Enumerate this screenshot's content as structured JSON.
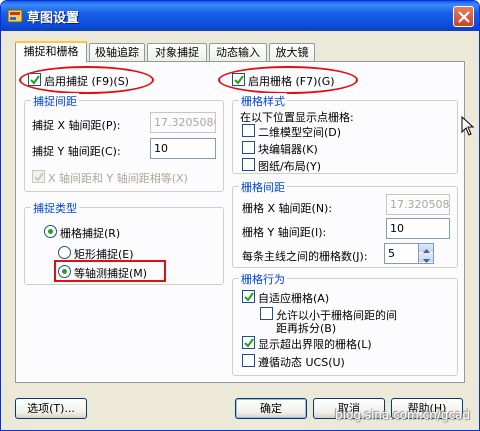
{
  "window": {
    "title": "草图设置"
  },
  "tabs": [
    {
      "label": "捕捉和栅格"
    },
    {
      "label": "极轴追踪"
    },
    {
      "label": "对象捕捉"
    },
    {
      "label": "动态输入"
    },
    {
      "label": "放大镜"
    }
  ],
  "snap": {
    "enable_label": "启用捕捉 (F9)(S)",
    "spacing_group": "捕捉间距",
    "x_label": "捕捉 X 轴间距(P):",
    "x_value": "17.3205080",
    "y_label": "捕捉 Y 轴间距(C):",
    "y_value": "10",
    "equal_label": "X 轴间距和 Y 轴间距相等(X)",
    "type_group": "捕捉类型",
    "grid_snap": "栅格捕捉(R)",
    "rect_snap": "矩形捕捉(E)",
    "iso_snap": "等轴测捕捉(M)"
  },
  "grid": {
    "enable_label": "启用栅格 (F7)(G)",
    "style_group": "栅格样式",
    "style_hint": "在以下位置显示点栅格:",
    "model_space": "二维模型空间(D)",
    "block_editor": "块编辑器(K)",
    "sheet_layout": "图纸/布局(Y)",
    "spacing_group": "栅格间距",
    "x_label": "栅格 X 轴间距(N):",
    "x_value": "17.3205080",
    "y_label": "栅格 Y 轴间距(I):",
    "y_value": "10",
    "major_label": "每条主线之间的栅格数(J):",
    "major_value": "5",
    "behavior_group": "栅格行为",
    "adaptive": "自适应栅格(A)",
    "allow_sub_1": "允许以小于栅格间距的间",
    "allow_sub_2": "距再拆分(B)",
    "beyond_limits": "显示超出界限的栅格(L)",
    "follow_ucs": "遵循动态 UCS(U)"
  },
  "buttons": {
    "options": "选项(T)...",
    "ok": "确定",
    "cancel": "取消",
    "help": "帮助(H)"
  },
  "watermark": "blog.sina.com.cn/gcad",
  "colors": {
    "titlebar": "#0b4ddb",
    "group_title": "#0046d5",
    "highlight": "#e01010",
    "checkmark": "#21a121"
  }
}
